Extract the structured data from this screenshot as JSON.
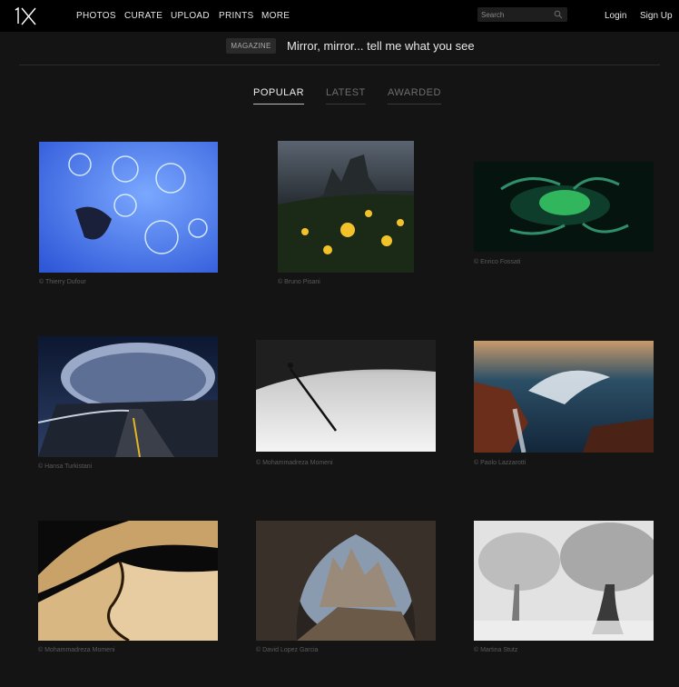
{
  "nav": {
    "logo": "1X",
    "items": [
      "PHOTOS",
      "CURATE",
      "UPLOAD",
      "PRINTS",
      "MORE"
    ],
    "search_placeholder": "Search",
    "login": "Login",
    "signup": "Sign Up"
  },
  "magazine": {
    "badge": "MAGAZINE",
    "title": "Mirror, mirror... tell me what you see"
  },
  "tabs": [
    "POPULAR",
    "LATEST",
    "AWARDED"
  ],
  "photos": [
    {
      "credit": "© Thierry Dufour"
    },
    {
      "credit": "© Bruno Pisani"
    },
    {
      "credit": "© Enrico Fossati"
    },
    {
      "credit": "© Hansa Turkistani"
    },
    {
      "credit": "© Mohammadreza Momeni"
    },
    {
      "credit": "© Paolo Lazzarotti"
    },
    {
      "credit": "© Mohammadreza Momeni"
    },
    {
      "credit": "© David Lopez Garcia"
    },
    {
      "credit": "© Martina Stutz"
    }
  ]
}
